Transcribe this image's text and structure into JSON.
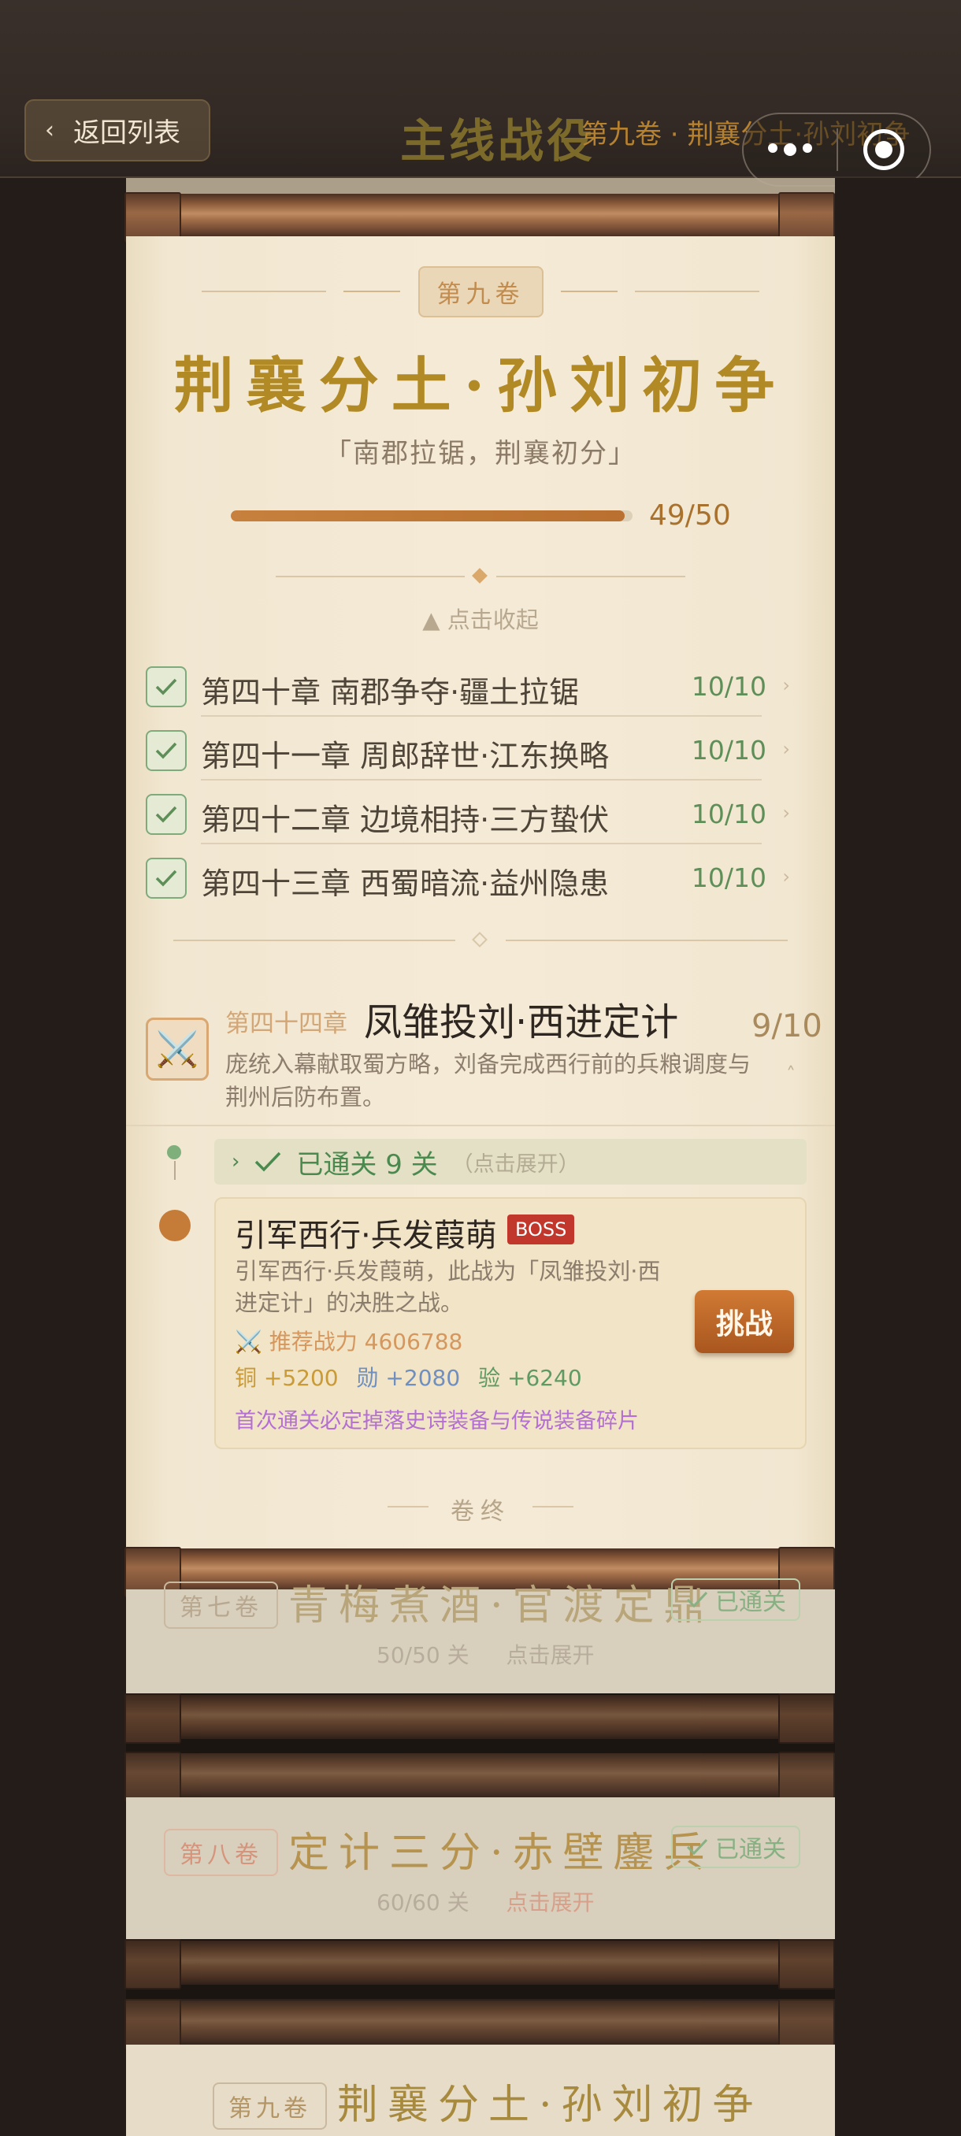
{
  "header": {
    "back_label": "返回列表",
    "page_title": "主线战役",
    "volume_subtitle": "第九卷 · 荆襄分土·孙刘初争"
  },
  "volume": {
    "tag": "第九卷",
    "title": "荆襄分土·孙刘初争",
    "quote": "「南郡拉锯，荆襄初分」",
    "progress_text": "49/50",
    "progress_fraction": 0.98,
    "collapse_label": "▲ 点击收起"
  },
  "chapters": [
    {
      "name": "第四十章 南郡争夺·疆土拉锯",
      "count": "10/10"
    },
    {
      "name": "第四十一章 周郎辞世·江东换略",
      "count": "10/10"
    },
    {
      "name": "第四十二章 边境相持·三方蛰伏",
      "count": "10/10"
    },
    {
      "name": "第四十三章 西蜀暗流·益州隐患",
      "count": "10/10"
    }
  ],
  "current_chapter": {
    "label": "第四十四章",
    "title": "凤雏投刘·西进定计",
    "count": "9/10",
    "desc": "庞统入幕献取蜀方略，刘备完成西行前的兵粮调度与荆州后防布置。"
  },
  "passed": {
    "text": "已通关 9 关",
    "hint": "（点击展开）"
  },
  "stage": {
    "title": "引军西行·兵发葭萌",
    "badge": "BOSS",
    "desc": "引军西行·兵发葭萌，此战为「凤雏投刘·西进定计」的决胜之战。",
    "power": "⚔️ 推荐战力 4606788",
    "reward_copper": "铜 +5200",
    "reward_merit": "勋 +2080",
    "reward_exp": "验 +6240",
    "drop": "首次通关必定掉落史诗装备与传说装备碎片",
    "challenge_label": "挑战"
  },
  "volume_end": "卷终",
  "other_volumes": [
    {
      "tag": "第七卷",
      "title": "青梅煮酒·官渡定鼎",
      "badge": "已通关",
      "stages": "50/50 关",
      "expand": "点击展开"
    },
    {
      "tag": "第八卷",
      "title": "定计三分·赤壁鏖兵",
      "badge": "已通关",
      "stages": "60/60 关",
      "expand": "点击展开"
    },
    {
      "tag": "第九卷",
      "title": "荆襄分土·孙刘初争"
    }
  ],
  "colors": {
    "accent_gold": "#b28a25",
    "progress": "#c7803d",
    "done_green": "#5e8f58",
    "boss_red": "#c2372b",
    "drop_purple": "#b46fd3"
  }
}
